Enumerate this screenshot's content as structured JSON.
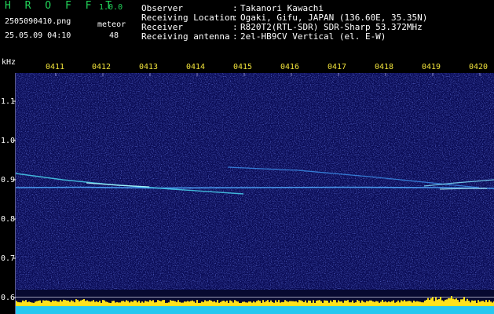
{
  "header": {
    "app_title": "H R O F F T",
    "app_version": "1.0.0",
    "file_name": "2505090410.png",
    "date_time": "25.05.09 04:10",
    "meteor_label": "meteor",
    "meteor_count": "48"
  },
  "info": [
    {
      "label": "Observer",
      "value": "Takanori Kawachi"
    },
    {
      "label": "Receiving Location",
      "value": "Ogaki, Gifu, JAPAN (136.60E, 35.35N)"
    },
    {
      "label": "Receiver",
      "value": "R820T2(RTL-SDR) SDR-Sharp 53.372MHz"
    },
    {
      "label": "Receiving antenna",
      "value": "2el-HB9CV Vertical (el. E-W)"
    }
  ],
  "info_separator": ":",
  "spectrogram": {
    "unit_label": "kHz",
    "time_labels": [
      "0411",
      "0412",
      "0413",
      "0414",
      "0415",
      "0416",
      "0417",
      "0418",
      "0419",
      "0420"
    ],
    "freq_labels": [
      "1.1",
      "1.0",
      "0.9",
      "0.8",
      "0.7",
      "0.6"
    ],
    "freq_values": [
      1.1,
      1.0,
      0.9,
      0.8,
      0.7,
      0.6
    ],
    "colors": {
      "background": "#0a0c56",
      "trace": "#4fa8ff",
      "trace_bright": "#b8ffff",
      "header_green": "#22d45a",
      "time_yellow": "#f0e23a",
      "activity_yellow": "#ffe21c",
      "activity_cyan": "#25c8f0"
    }
  }
}
